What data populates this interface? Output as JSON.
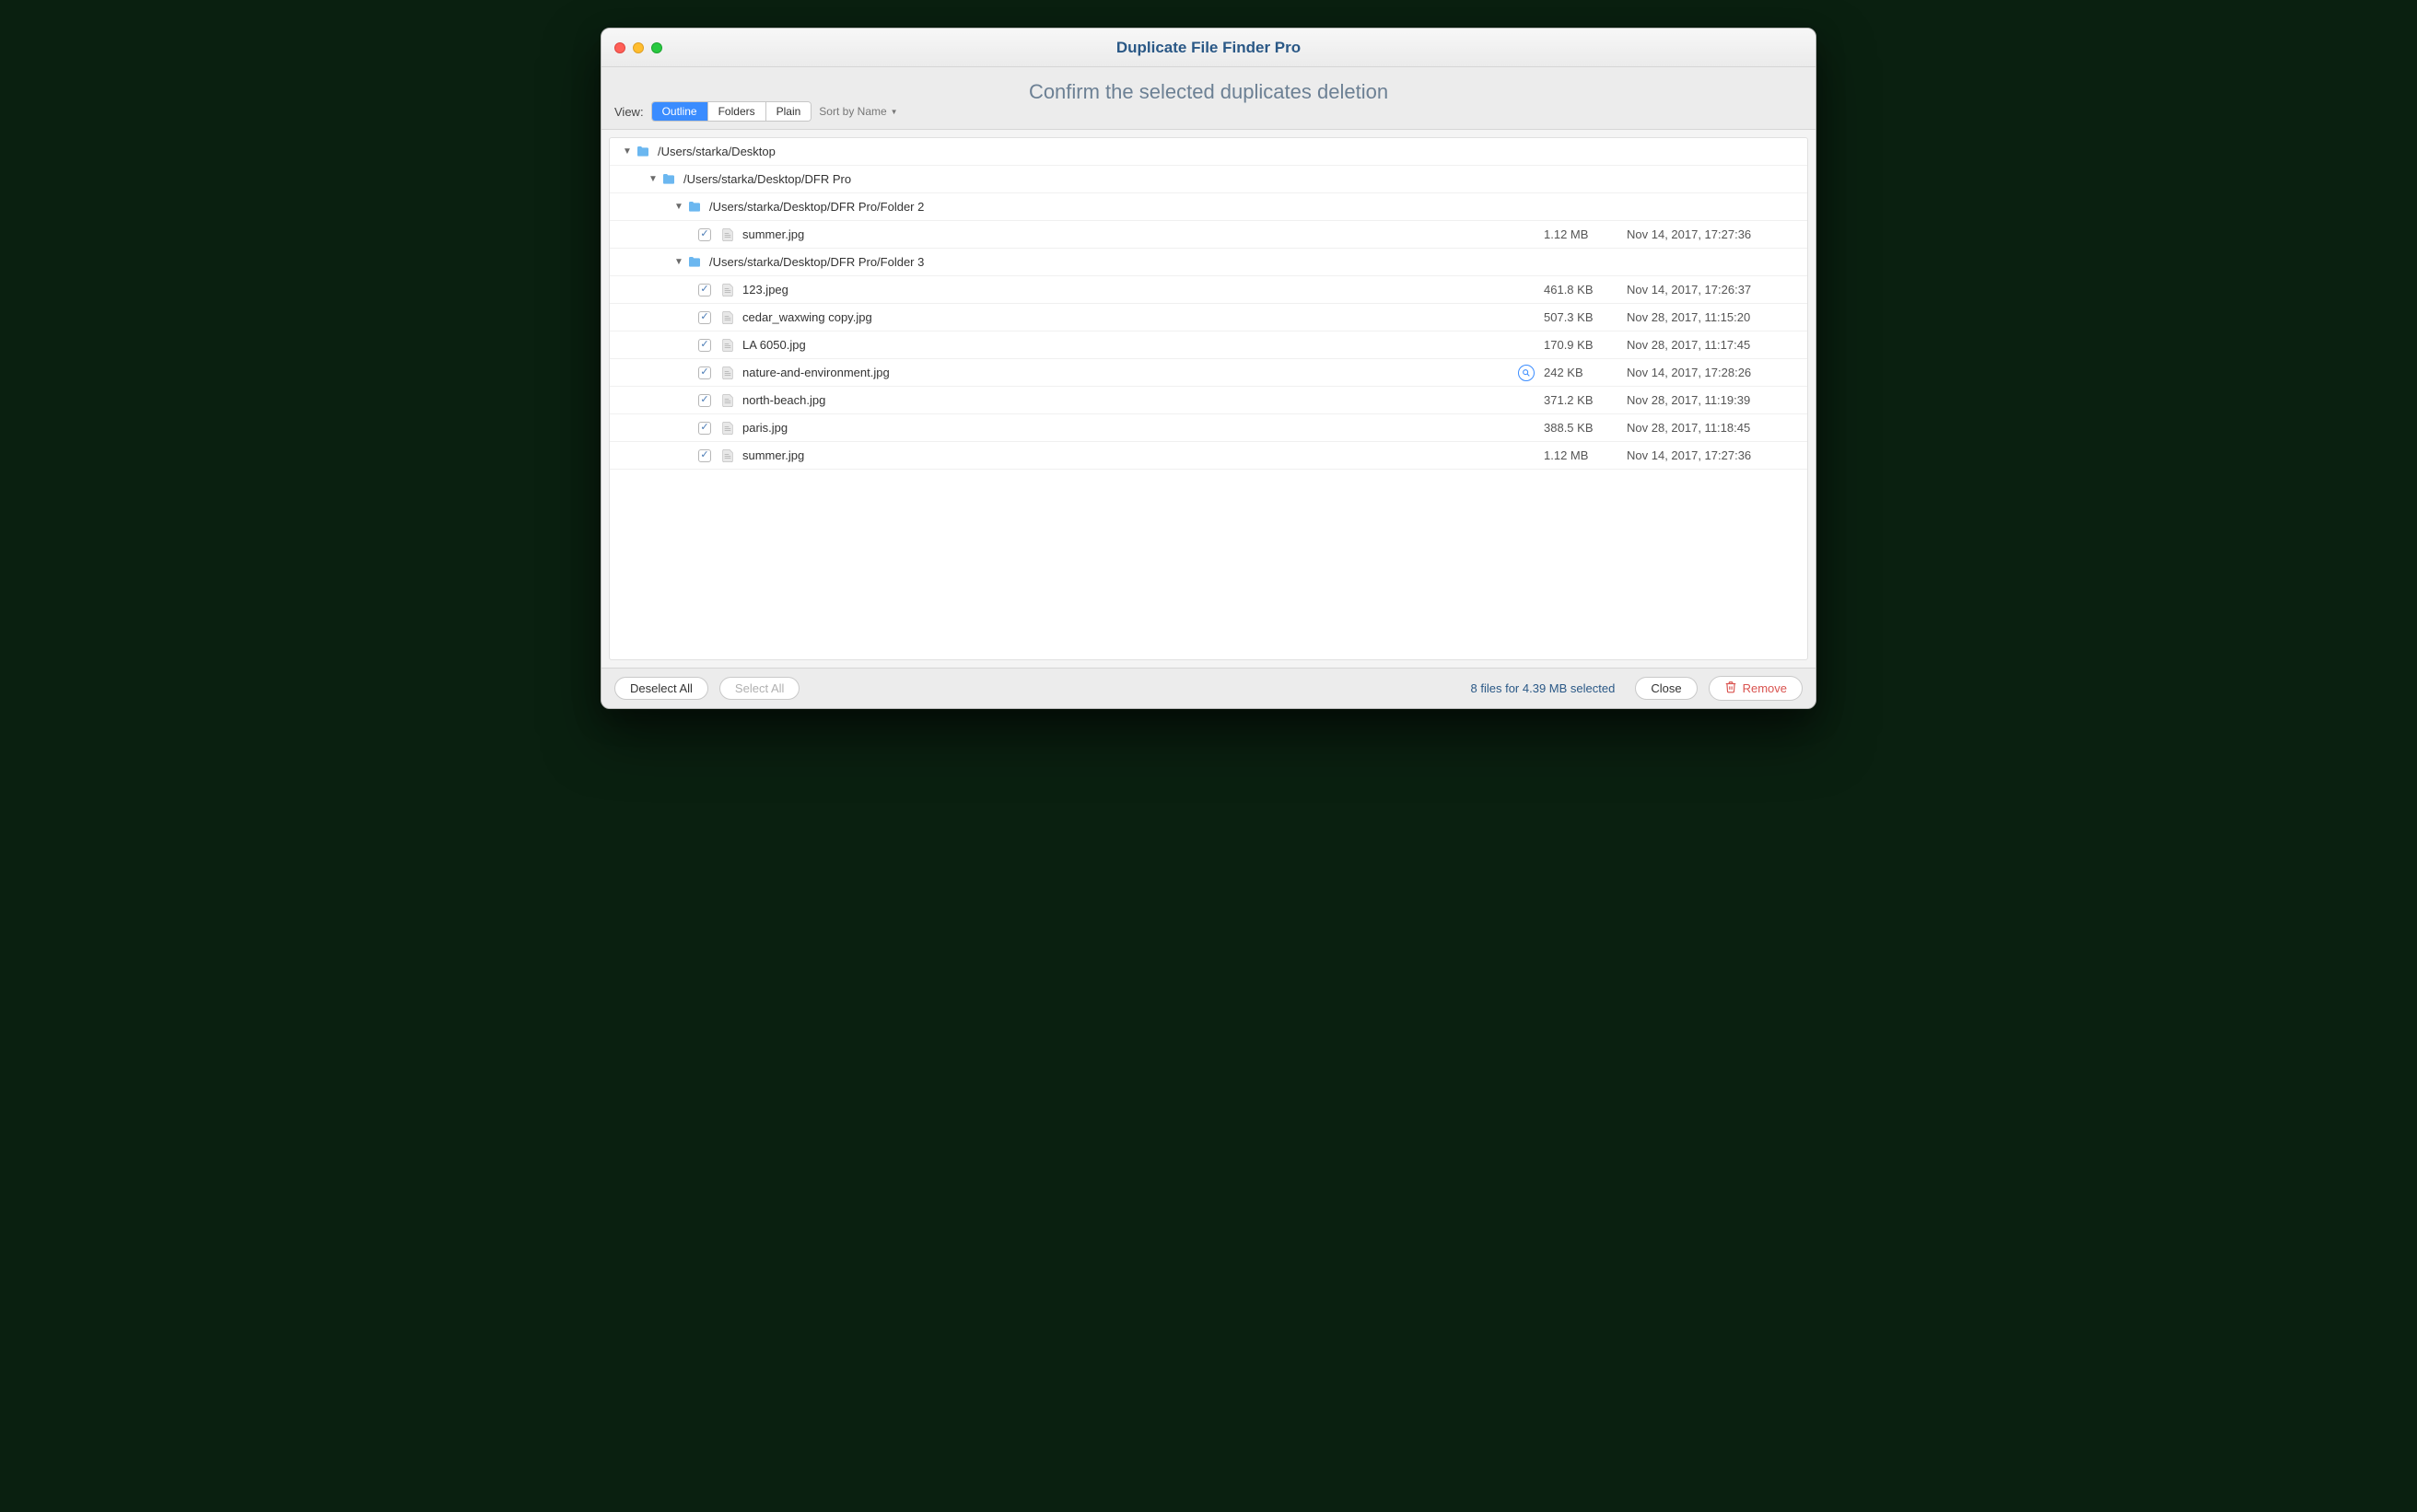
{
  "window": {
    "title": "Duplicate File Finder Pro"
  },
  "header": {
    "subtitle": "Confirm the selected duplicates deletion",
    "view_label": "View:",
    "view_modes": [
      "Outline",
      "Folders",
      "Plain"
    ],
    "view_active": 0,
    "sort_label": "Sort by Name"
  },
  "tree": [
    {
      "type": "folder",
      "level": 0,
      "expanded": true,
      "path": "/Users/starka/Desktop",
      "children": [
        {
          "type": "folder",
          "level": 1,
          "expanded": true,
          "path": "/Users/starka/Desktop/DFR Pro",
          "children": [
            {
              "type": "folder",
              "level": 2,
              "expanded": true,
              "path": "/Users/starka/Desktop/DFR Pro/Folder 2",
              "children": [
                {
                  "type": "file",
                  "level": 3,
                  "checked": true,
                  "name": "summer.jpg",
                  "size": "1.12 MB",
                  "date": "Nov 14, 2017, 17:27:36"
                }
              ]
            },
            {
              "type": "folder",
              "level": 2,
              "expanded": true,
              "path": "/Users/starka/Desktop/DFR Pro/Folder 3",
              "children": [
                {
                  "type": "file",
                  "level": 3,
                  "checked": true,
                  "name": "123.jpeg",
                  "size": "461.8 KB",
                  "date": "Nov 14, 2017, 17:26:37"
                },
                {
                  "type": "file",
                  "level": 3,
                  "checked": true,
                  "name": "cedar_waxwing copy.jpg",
                  "size": "507.3 KB",
                  "date": "Nov 28, 2017, 11:15:20"
                },
                {
                  "type": "file",
                  "level": 3,
                  "checked": true,
                  "name": "LA 6050.jpg",
                  "size": "170.9 KB",
                  "date": "Nov 28, 2017, 11:17:45"
                },
                {
                  "type": "file",
                  "level": 3,
                  "checked": true,
                  "name": "nature-and-environment.jpg",
                  "size": "242 KB",
                  "date": "Nov 14, 2017, 17:28:26",
                  "preview": true
                },
                {
                  "type": "file",
                  "level": 3,
                  "checked": true,
                  "name": "north-beach.jpg",
                  "size": "371.2 KB",
                  "date": "Nov 28, 2017, 11:19:39"
                },
                {
                  "type": "file",
                  "level": 3,
                  "checked": true,
                  "name": "paris.jpg",
                  "size": "388.5 KB",
                  "date": "Nov 28, 2017, 11:18:45"
                },
                {
                  "type": "file",
                  "level": 3,
                  "checked": true,
                  "name": "summer.jpg",
                  "size": "1.12 MB",
                  "date": "Nov 14, 2017, 17:27:36"
                }
              ]
            }
          ]
        }
      ]
    }
  ],
  "footer": {
    "deselect_all": "Deselect All",
    "select_all": "Select All",
    "status": "8 files for 4.39 MB selected",
    "close": "Close",
    "remove": "Remove"
  }
}
